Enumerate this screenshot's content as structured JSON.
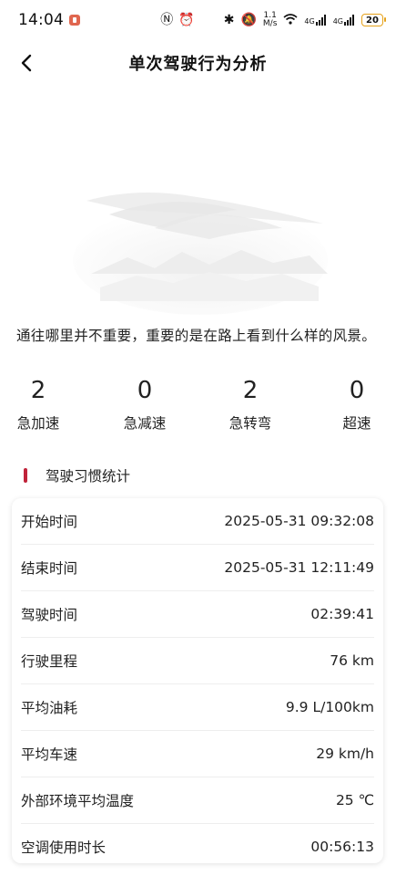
{
  "status_bar": {
    "time": "14:04",
    "speed_value": "1.1",
    "speed_unit": "M/s",
    "net1": "4G",
    "net2": "4G",
    "battery": "20"
  },
  "header": {
    "title": "单次驾驶行为分析"
  },
  "quote": "通往哪里并不重要，重要的是在路上看到什么样的风景。",
  "stats": [
    {
      "value": "2",
      "label": "急加速"
    },
    {
      "value": "0",
      "label": "急减速"
    },
    {
      "value": "2",
      "label": "急转弯"
    },
    {
      "value": "0",
      "label": "超速"
    }
  ],
  "section": {
    "title": "驾驶习惯统计"
  },
  "rows": [
    {
      "label": "开始时间",
      "value": "2025-05-31 09:32:08"
    },
    {
      "label": "结束时间",
      "value": "2025-05-31 12:11:49"
    },
    {
      "label": "驾驶时间",
      "value": "02:39:41"
    },
    {
      "label": "行驶里程",
      "value": "76 km"
    },
    {
      "label": "平均油耗",
      "value": "9.9 L/100km"
    },
    {
      "label": "平均车速",
      "value": "29 km/h"
    },
    {
      "label": "外部环境平均温度",
      "value": "25 ℃"
    },
    {
      "label": "空调使用时长",
      "value": "00:56:13"
    }
  ],
  "colors": {
    "accent": "#c0233a",
    "battery": "#e6a21b"
  }
}
